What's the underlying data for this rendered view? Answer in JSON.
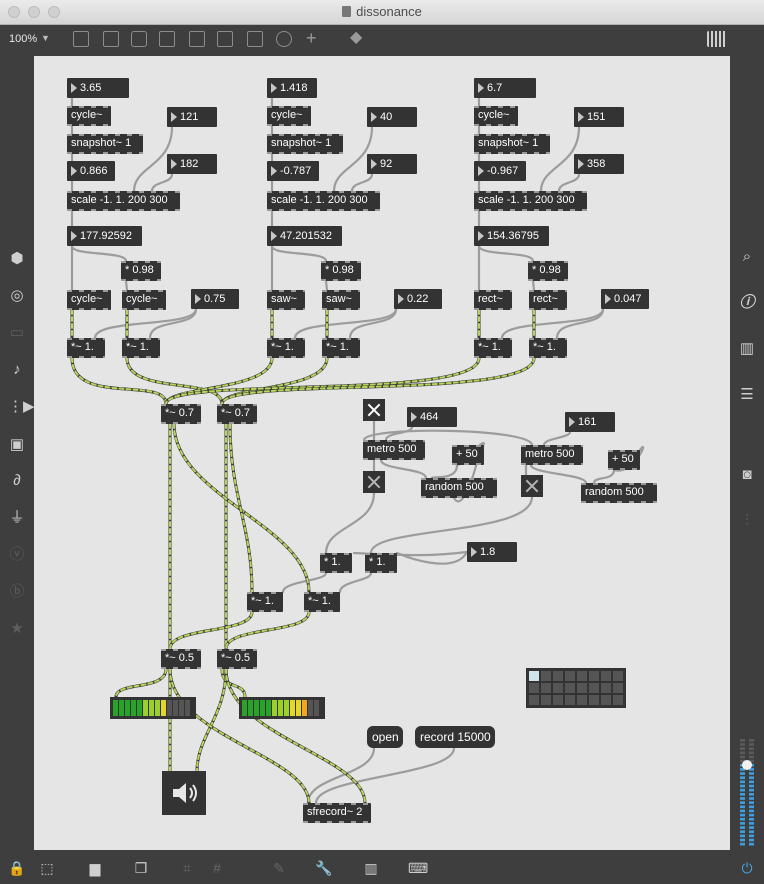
{
  "window": {
    "title": "dissonance"
  },
  "toolbar": {
    "zoom": "100%"
  },
  "patch": {
    "voices": [
      {
        "freq": "3.65",
        "osc": "cycle~",
        "snapshot": "snapshot~ 1",
        "snap_value": "0.866",
        "scale_min": "121",
        "scale_max": "182",
        "scale": "scale -1. 1. 200 300",
        "scaled": "177.92592",
        "mult": "* 0.98",
        "osc_a": "cycle~",
        "osc_b": "cycle~",
        "gain": "0.75",
        "gain_a": "*~ 1.",
        "gain_b": "*~ 1."
      },
      {
        "freq": "1.418",
        "osc": "cycle~",
        "snapshot": "snapshot~ 1",
        "snap_value": "-0.787",
        "scale_min": "40",
        "scale_max": "92",
        "scale": "scale -1. 1. 200 300",
        "scaled": "47.201532",
        "mult": "* 0.98",
        "osc_a": "saw~",
        "osc_b": "saw~",
        "gain": "0.22",
        "gain_a": "*~ 1.",
        "gain_b": "*~ 1."
      },
      {
        "freq": "6.7",
        "osc": "cycle~",
        "snapshot": "snapshot~ 1",
        "snap_value": "-0.967",
        "scale_min": "151",
        "scale_max": "358",
        "scale": "scale -1. 1. 200 300",
        "scaled": "154.36795",
        "mult": "* 0.98",
        "osc_a": "rect~",
        "osc_b": "rect~",
        "gain": "0.047",
        "gain_a": "*~ 1.",
        "gain_b": "*~ 1."
      }
    ],
    "mix_left": "*~ 0.7",
    "mix_right": "*~ 0.7",
    "randomizers": [
      {
        "interval": "464",
        "metro": "metro 500",
        "add": "+ 50",
        "random": "random 500"
      },
      {
        "interval": "161",
        "metro": "metro 500",
        "add": "+ 50",
        "random": "random 500"
      }
    ],
    "env_a": "* 1.",
    "env_b": "* 1.",
    "env_depth": "1.8",
    "pan_left": "*~ 1.",
    "pan_right": "*~ 1.",
    "out_left": "*~ 0.5",
    "out_right": "*~ 0.5",
    "open_label": "open",
    "record_label": "record 15000",
    "sfrecord": "sfrecord~ 2",
    "meter_left_level": 0.72,
    "meter_right_level": 0.87,
    "master_gain_level": 0.75
  },
  "colors": {
    "patch_cord": "#9c9c9c",
    "signal_cord_dash": "#b6d35b",
    "object_bg": "#333333",
    "canvas": "#e5e5e5"
  }
}
